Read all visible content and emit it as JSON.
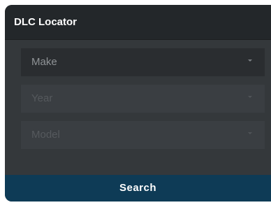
{
  "widget": {
    "title": "DLC Locator"
  },
  "form": {
    "make": {
      "label": "Make",
      "icon": "chevron-down-icon"
    },
    "year": {
      "label": "Year",
      "icon": "chevron-down-icon"
    },
    "model": {
      "label": "Model",
      "icon": "chevron-down-icon"
    }
  },
  "actions": {
    "search_label": "Search"
  },
  "colors": {
    "header_bg": "#23272a",
    "panel_bg": "#34383b",
    "button_bg": "#0e3b56",
    "text_primary": "#ffffff"
  }
}
